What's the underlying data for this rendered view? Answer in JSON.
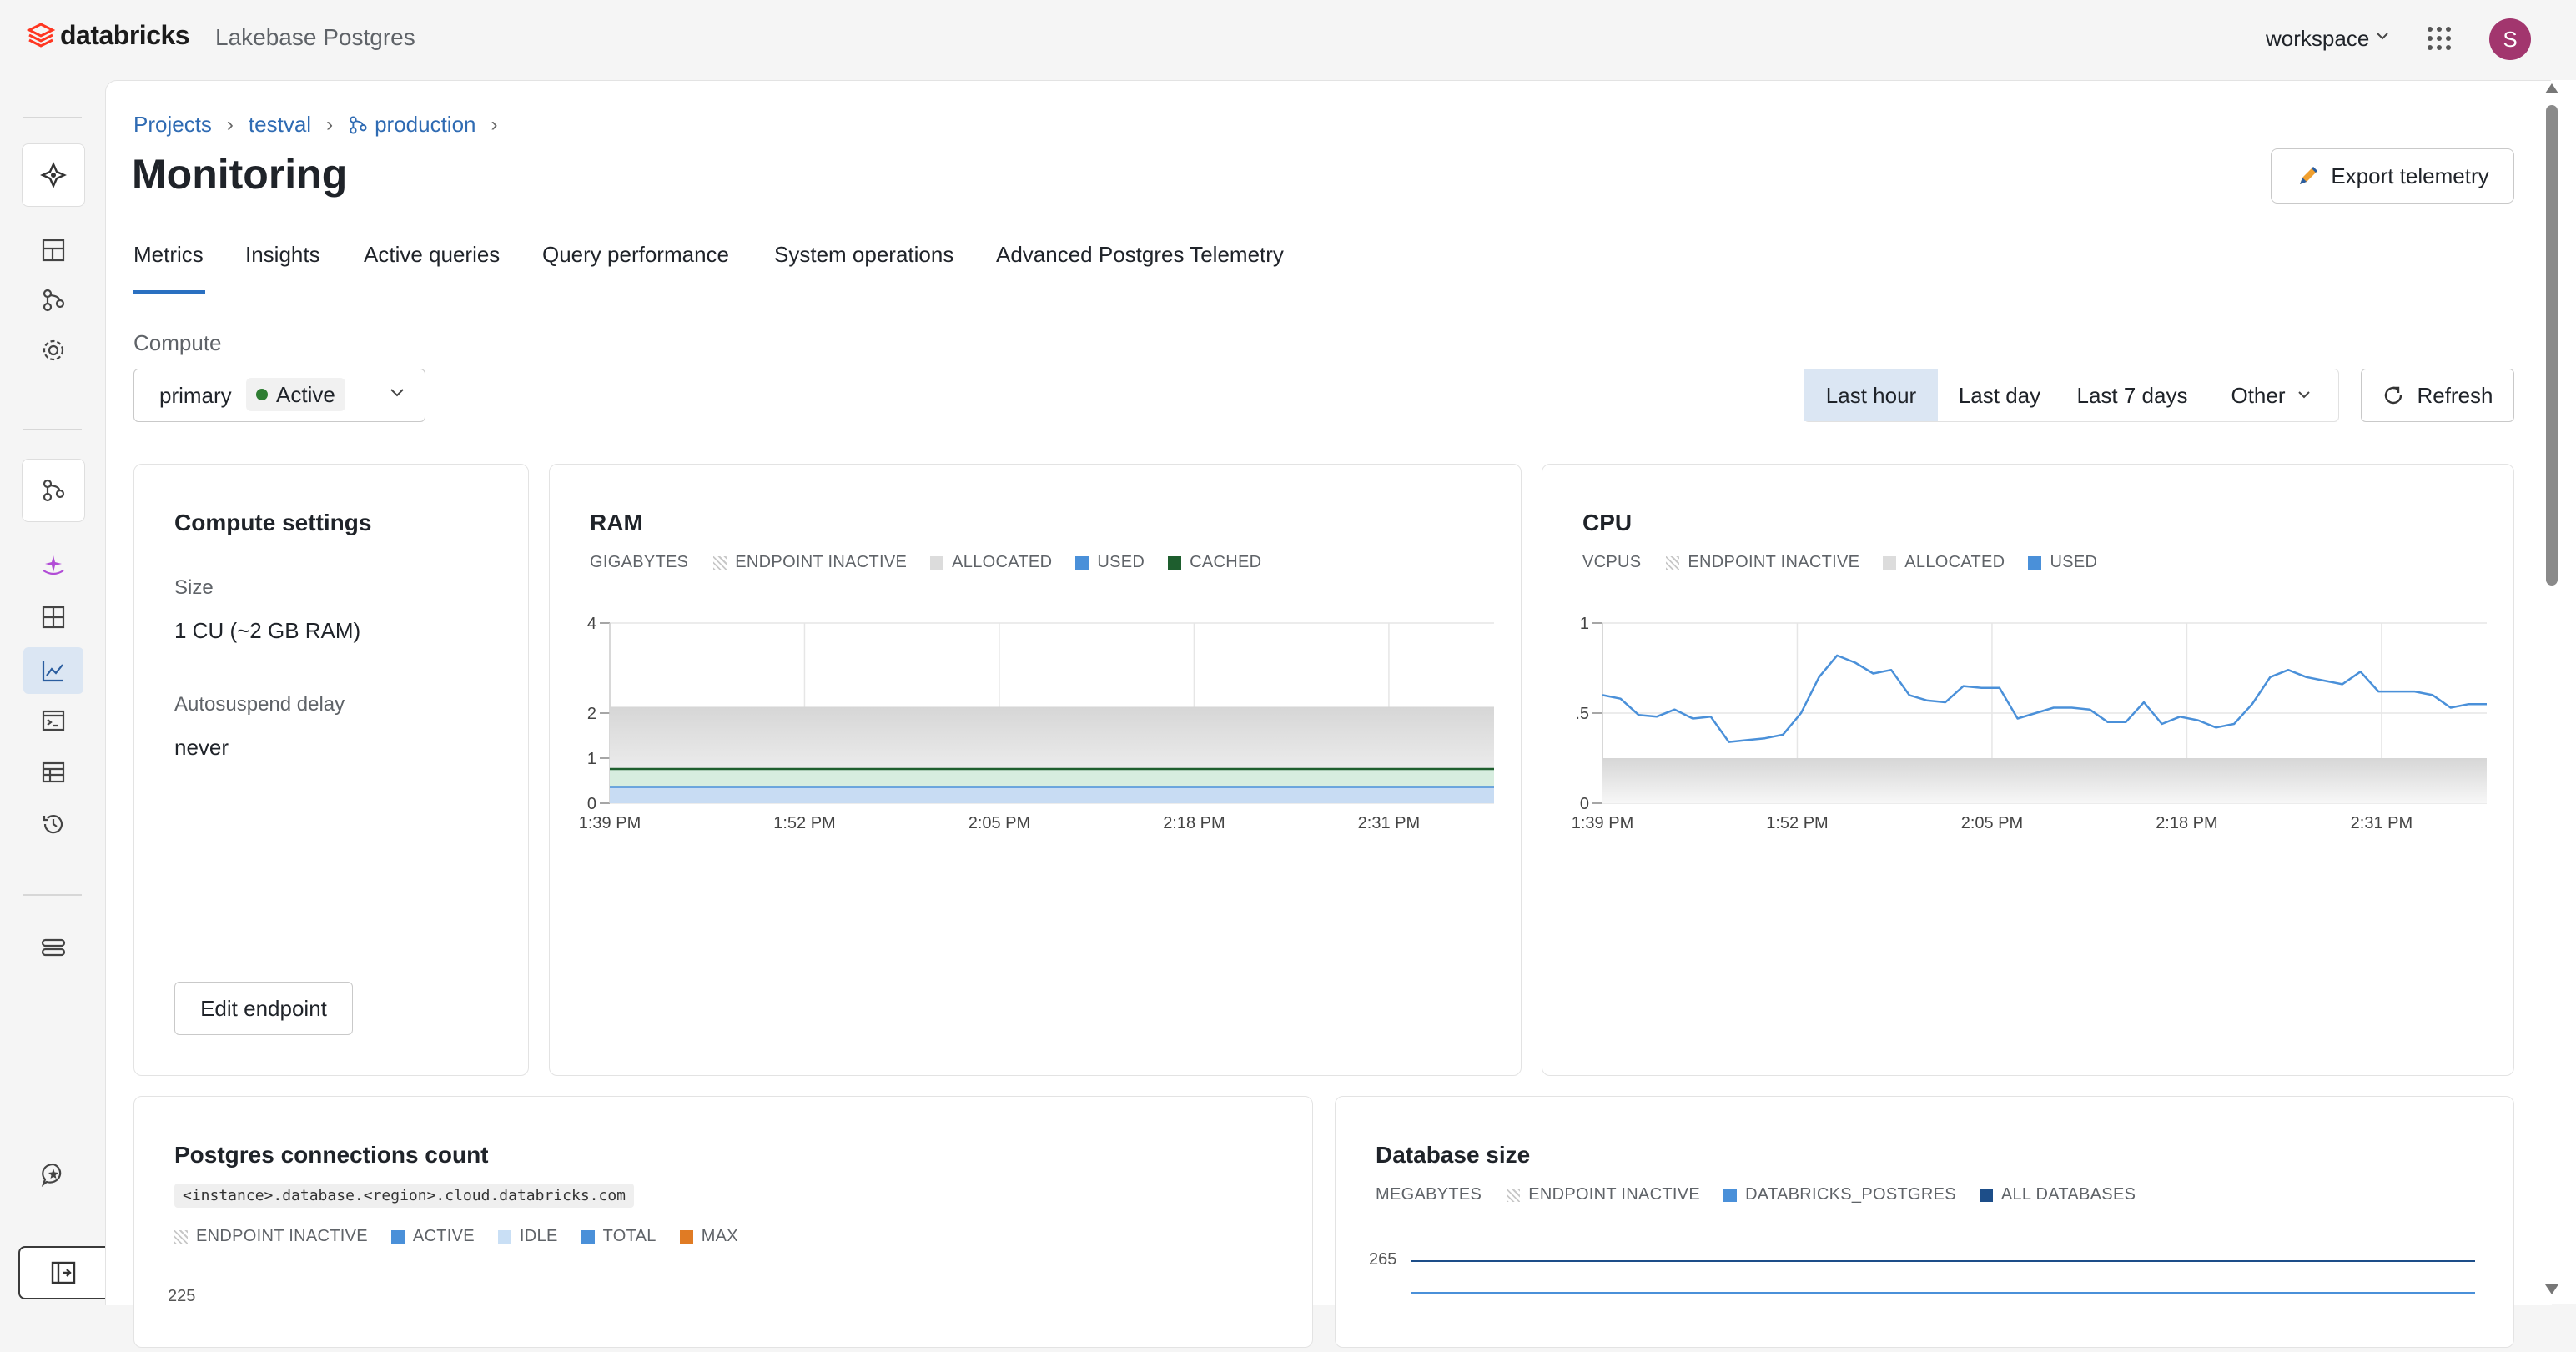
{
  "app": {
    "brand": "databricks",
    "product": "Lakebase Postgres",
    "workspace": "workspace",
    "avatar_initial": "S"
  },
  "breadcrumb": [
    "Projects",
    "testval",
    "production"
  ],
  "page": {
    "title": "Monitoring",
    "export_label": "Export telemetry"
  },
  "tabs": [
    "Metrics",
    "Insights",
    "Active queries",
    "Query performance",
    "System operations",
    "Advanced Postgres Telemetry"
  ],
  "active_tab": "Metrics",
  "compute": {
    "label": "Compute",
    "value": "primary",
    "status": "Active"
  },
  "time_range": {
    "options": [
      "Last hour",
      "Last day",
      "Last 7 days",
      "Other"
    ],
    "selected": "Last hour"
  },
  "refresh_label": "Refresh",
  "settings_card": {
    "title": "Compute settings",
    "size_label": "Size",
    "size_value": "1 CU (~2 GB RAM)",
    "autosuspend_label": "Autosuspend delay",
    "autosuspend_value": "never",
    "edit_label": "Edit endpoint"
  },
  "connections_card": {
    "title": "Postgres connections count",
    "host": "<instance>.database.<region>.cloud.databricks.com",
    "legend": [
      "ENDPOINT INACTIVE",
      "ACTIVE",
      "IDLE",
      "TOTAL",
      "MAX"
    ],
    "first_tick": "225"
  },
  "dbsize_card": {
    "title": "Database size",
    "unit": "MEGABYTES",
    "legend": [
      "ENDPOINT INACTIVE",
      "DATABRICKS_POSTGRES",
      "ALL DATABASES"
    ],
    "first_tick": "265"
  },
  "colors": {
    "used": "#4a90d9",
    "cached": "#1e5e2e",
    "allocated": "#dcdcdc",
    "accent": "#2a70c1",
    "active_dot": "#2e7d32",
    "max": "#e07b24",
    "all_databases": "#1d4e89"
  },
  "chart_data": [
    {
      "type": "area",
      "title": "RAM",
      "ylabel": "GIGABYTES",
      "legend": [
        "ENDPOINT INACTIVE",
        "ALLOCATED",
        "USED",
        "CACHED"
      ],
      "x_ticks": [
        "1:39 PM",
        "1:52 PM",
        "2:05 PM",
        "2:18 PM",
        "2:31 PM"
      ],
      "y_ticks": [
        "0",
        "1",
        "2",
        "4"
      ],
      "ylim": [
        0,
        4
      ],
      "series": [
        {
          "name": "ALLOCATED",
          "values": [
            2.14,
            2.14,
            2.14,
            2.14,
            2.14,
            2.14
          ]
        },
        {
          "name": "CACHED",
          "values": [
            0.76,
            0.76,
            0.76,
            0.76,
            0.76,
            0.76
          ]
        },
        {
          "name": "USED",
          "values": [
            0.36,
            0.36,
            0.36,
            0.36,
            0.36,
            0.36
          ]
        }
      ]
    },
    {
      "type": "line",
      "title": "CPU",
      "ylabel": "VCPUS",
      "legend": [
        "ENDPOINT INACTIVE",
        "ALLOCATED",
        "USED"
      ],
      "x_ticks": [
        "1:39 PM",
        "1:52 PM",
        "2:05 PM",
        "2:18 PM",
        "2:31 PM"
      ],
      "y_ticks": [
        "0",
        ".5",
        "1"
      ],
      "ylim": [
        0,
        1
      ],
      "series": [
        {
          "name": "ALLOCATED",
          "values": [
            0.25,
            0.25
          ]
        },
        {
          "name": "USED",
          "values": [
            0.6,
            0.58,
            0.49,
            0.48,
            0.52,
            0.47,
            0.48,
            0.34,
            0.35,
            0.36,
            0.38,
            0.5,
            0.7,
            0.82,
            0.78,
            0.72,
            0.74,
            0.6,
            0.57,
            0.56,
            0.65,
            0.64,
            0.64,
            0.47,
            0.5,
            0.53,
            0.53,
            0.52,
            0.45,
            0.45,
            0.56,
            0.44,
            0.48,
            0.46,
            0.42,
            0.44,
            0.55,
            0.7,
            0.74,
            0.7,
            0.68,
            0.66,
            0.73,
            0.62,
            0.62,
            0.62,
            0.6,
            0.53,
            0.55,
            0.55
          ]
        }
      ]
    }
  ]
}
